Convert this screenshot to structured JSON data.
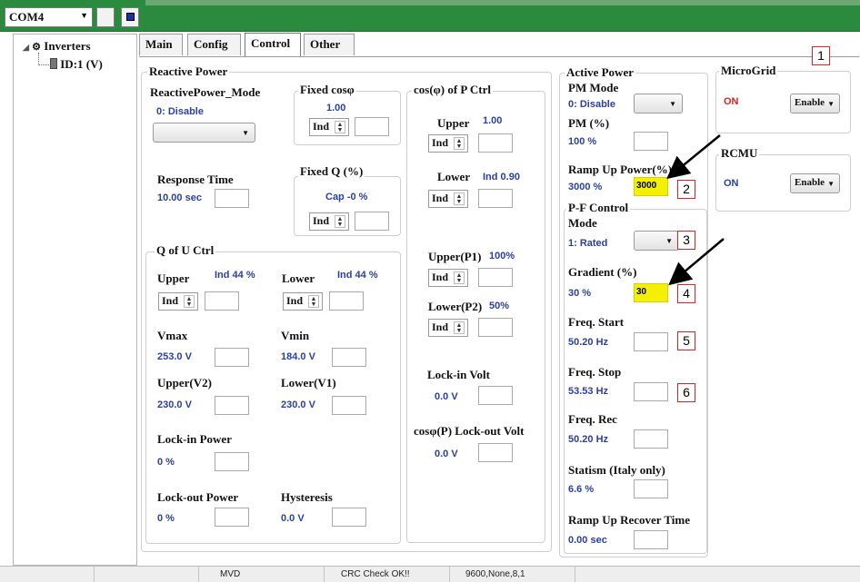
{
  "toolbar": {
    "port": "COM4"
  },
  "tree": {
    "root": "Inverters",
    "node": "ID:1 (V)"
  },
  "tabs": [
    "Main",
    "Config",
    "Control",
    "Other"
  ],
  "reactive": {
    "title": "Reactive Power",
    "mode_label": "ReactivePower_Mode",
    "mode_value": "0: Disable",
    "fixed_cos_title": "Fixed cosφ",
    "fixed_cos_value": "1.00",
    "fixed_cos_sel": "Ind",
    "fixed_q_title": "Fixed Q (%)",
    "fixed_q_value": "Cap -0 %",
    "fixed_q_sel": "Ind",
    "response_label": "Response Time",
    "response_value": "10.00 sec",
    "qou_title": "Q of U Ctrl",
    "upper_label": "Upper",
    "upper_value": "Ind 44 %",
    "upper_sel": "Ind",
    "lower_label": "Lower",
    "lower_value": "Ind 44 %",
    "lower_sel": "Ind",
    "vmax_label": "Vmax",
    "vmax_value": "253.0 V",
    "vmin_label": "Vmin",
    "vmin_value": "184.0 V",
    "upperv2_label": "Upper(V2)",
    "upperv2_value": "230.0 V",
    "lowerv1_label": "Lower(V1)",
    "lowerv1_value": "230.0 V",
    "lockin_label": "Lock-in Power",
    "lockin_value": "0 %",
    "lockout_label": "Lock-out Power",
    "lockout_value": "0 %",
    "hyst_label": "Hysteresis",
    "hyst_value": "0.0 V"
  },
  "cosp": {
    "title": "cos(φ) of P Ctrl",
    "upper_label": "Upper",
    "upper_value": "1.00",
    "upper_sel": "Ind",
    "lower_label": "Lower",
    "lower_value": "Ind 0.90",
    "lower_sel": "Ind",
    "p1_label": "Upper(P1)",
    "p1_value": "100%",
    "p1_sel": "Ind",
    "p2_label": "Lower(P2)",
    "p2_value": "50%",
    "p2_sel": "Ind",
    "lockin_label": "Lock-in Volt",
    "lockin_value": "0.0 V",
    "lockout_label": "cosφ(P) Lock-out Volt",
    "lockout_value": "0.0 V"
  },
  "active": {
    "title": "Active Power",
    "pm_mode_label": "PM Mode",
    "pm_mode_value": "0: Disable",
    "pm_label": "PM (%)",
    "pm_value": "100 %",
    "ramp_label": "Ramp Up Power(%)",
    "ramp_value": "3000 %",
    "ramp_input": "3000",
    "pf_title": "P-F Control",
    "pf_mode_label": "Mode",
    "pf_mode_value": "1: Rated",
    "gradient_label": "Gradient (%)",
    "gradient_value": "30 %",
    "gradient_input": "30",
    "fstart_label": "Freq. Start",
    "fstart_value": "50.20 Hz",
    "fstop_label": "Freq. Stop",
    "fstop_value": "53.53 Hz",
    "frec_label": "Freq. Rec",
    "frec_value": "50.20 Hz",
    "statism_label": "Statism (Italy only)",
    "statism_value": "6.6 %",
    "ramp_rec_label": "Ramp Up Recover Time",
    "ramp_rec_value": "0.00 sec"
  },
  "microgrid": {
    "title": "MicroGrid",
    "status": "ON",
    "select": "Enable"
  },
  "rcmu": {
    "title": "RCMU",
    "status": "ON",
    "select": "Enable"
  },
  "callouts": [
    "1",
    "2",
    "3",
    "4",
    "5",
    "6"
  ],
  "statusbar": {
    "mode": "MVD",
    "crc": "CRC Check OK!!",
    "comm": "9600,None,8,1"
  },
  "colors": {
    "accent_blue": "#2a3fa0",
    "highlight": "#f4f000",
    "callout": "#d22222",
    "titlebar": "#2a8a3e"
  }
}
